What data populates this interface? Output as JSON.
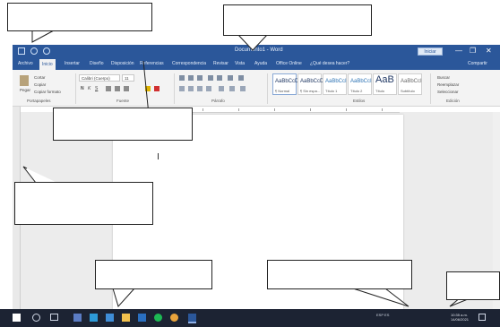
{
  "titlebar": {
    "doc_title": "Documento1 - Word",
    "signin": "Iniciar sesión",
    "minimize": "—",
    "restore": "❐",
    "close": "✕"
  },
  "tabs": {
    "items": [
      "Archivo",
      "Inicio",
      "Insertar",
      "Diseño",
      "Disposición",
      "Referencias",
      "Correspondencia",
      "Revisar",
      "Vista",
      "Ayuda",
      "Office Online"
    ],
    "tell_me": "¿Qué desea hacer?",
    "share": "Compartir"
  },
  "ribbon": {
    "paste": "Pegar",
    "cut": "Cortar",
    "copy": "Copiar",
    "format_painter": "Copiar formato",
    "font_name": "Calibri (Cuerpo)",
    "font_size": "11",
    "bold": "N",
    "italic": "K",
    "underline": "S",
    "groups": {
      "clipboard": "Portapapeles",
      "font": "Fuente",
      "paragraph": "Párrafo",
      "styles": "Estilos",
      "editing": "Edición"
    },
    "styles": [
      {
        "sample": "AaBbCcDd",
        "name": "¶ Normal"
      },
      {
        "sample": "AaBbCcDd",
        "name": "¶ Sin espa..."
      },
      {
        "sample": "AaBbCcI",
        "name": "Título 1"
      },
      {
        "sample": "AaBbCcI",
        "name": "Título 2"
      },
      {
        "sample": "AaB",
        "name": "Título"
      },
      {
        "sample": "AaBbCcI",
        "name": "Subtítulo"
      }
    ],
    "find": "Buscar",
    "replace": "Reemplazar",
    "select": "Seleccionar"
  },
  "tray": {
    "text": "ESP  ES",
    "time": "10:35 a.m.",
    "date": "14/06/2021"
  },
  "colors": {
    "brand": "#2b579a",
    "taskbar": "#1c2333"
  }
}
